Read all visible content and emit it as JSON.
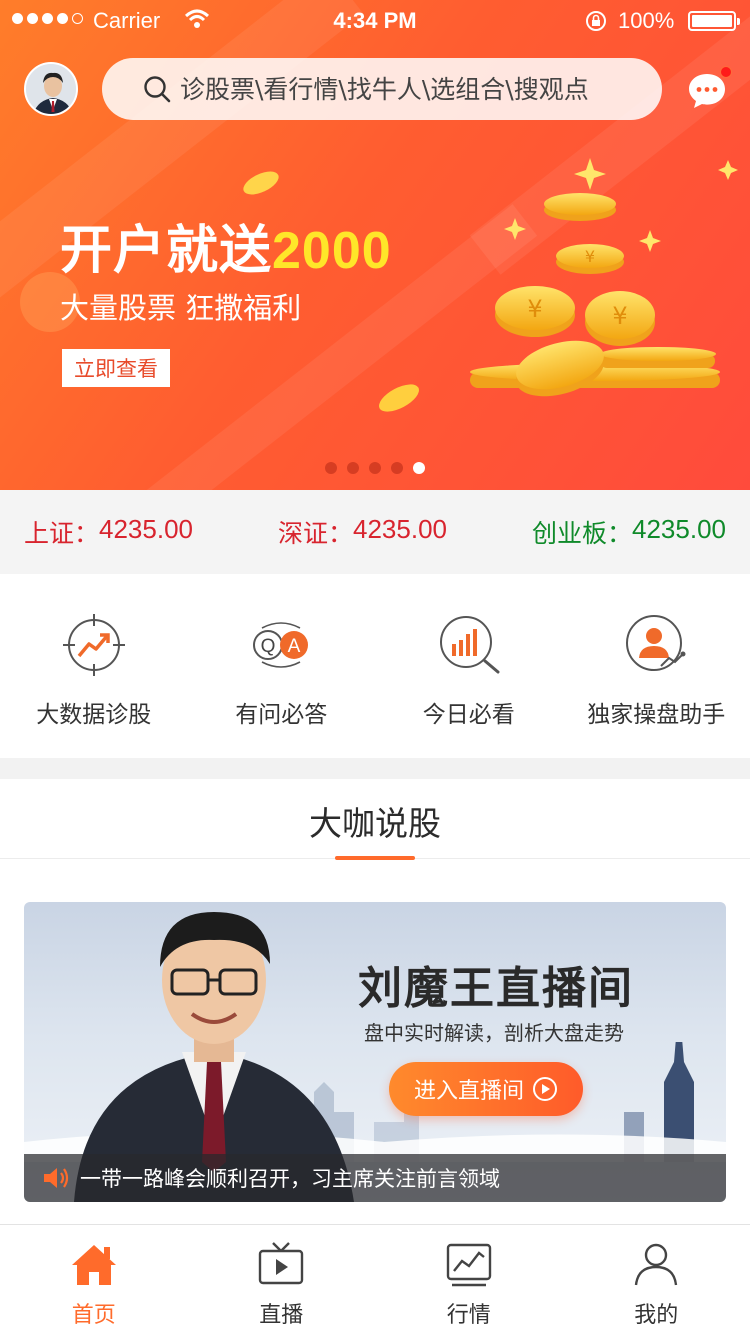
{
  "status_bar": {
    "carrier": "Carrier",
    "time": "4:34 PM",
    "battery": "100%"
  },
  "header": {
    "search_placeholder": "诊股票\\看行情\\找牛人\\选组合\\搜观点",
    "has_unread_messages": true
  },
  "banner": {
    "title": "开户就送",
    "title_amount": "2000",
    "subtitle": "大量股票  狂撒福利",
    "button": "立即查看",
    "slide_count": 5,
    "active_slide": 5
  },
  "indexes": [
    {
      "label": "上证：",
      "value": "4235.00",
      "color": "#d8242e"
    },
    {
      "label": "深证：",
      "value": "4235.00",
      "color": "#d8242e"
    },
    {
      "label": "创业板：",
      "value": "4235.00",
      "color": "#0f8a2a"
    }
  ],
  "shortcuts": [
    {
      "label": "大数据诊股",
      "icon": "target-trend-icon"
    },
    {
      "label": "有问必答",
      "icon": "qa-icon"
    },
    {
      "label": "今日必看",
      "icon": "chart-search-icon"
    },
    {
      "label": "独家操盘助手",
      "icon": "advisor-icon"
    }
  ],
  "section": {
    "title": "大咖说股",
    "card": {
      "title": "刘魔王直播间",
      "subtitle": "盘中实时解读，剖析大盘走势",
      "button": "进入直播间",
      "ticker": "一带一路峰会顺利召开，习主席关注前言领域"
    }
  },
  "tabbar": [
    {
      "label": "首页",
      "icon": "home-icon",
      "active": true
    },
    {
      "label": "直播",
      "icon": "tv-play-icon",
      "active": false
    },
    {
      "label": "行情",
      "icon": "market-chart-icon",
      "active": false
    },
    {
      "label": "我的",
      "icon": "user-icon",
      "active": false
    }
  ],
  "colors": {
    "accent": "#ff6b2b",
    "rise": "#d8242e",
    "fall": "#0f8a2a",
    "promo_amount": "#ffe629"
  }
}
